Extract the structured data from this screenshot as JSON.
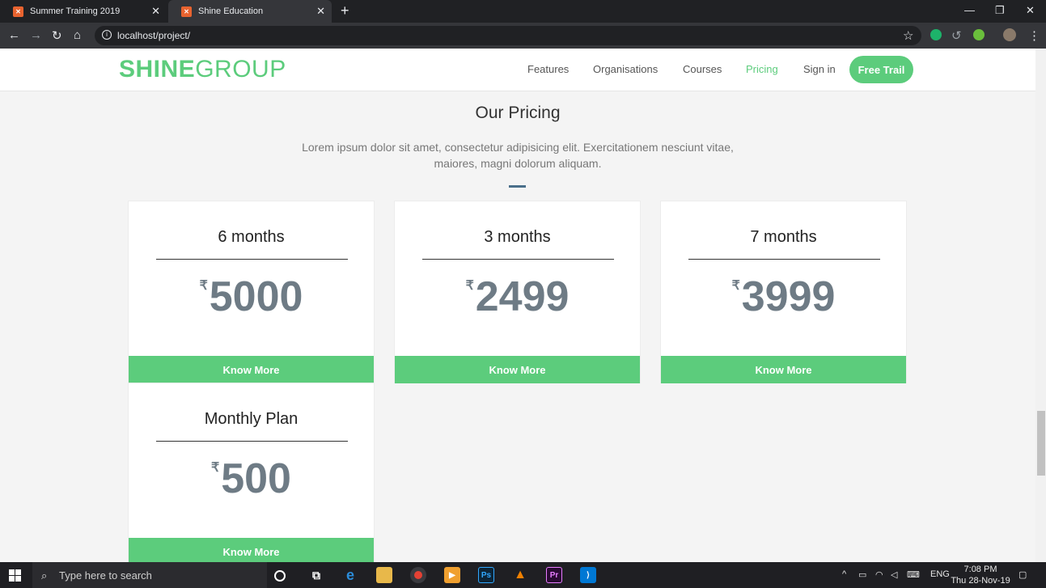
{
  "browser": {
    "tabs": [
      {
        "title": "Summer Training 2019"
      },
      {
        "title": "Shine Education"
      }
    ],
    "url": "localhost/project/"
  },
  "site": {
    "logo_part1": "SHINE",
    "logo_part2": "GROUP",
    "nav": [
      "Features",
      "Organisations",
      "Courses",
      "Pricing",
      "Sign in"
    ],
    "active_nav": "Pricing",
    "cta": "Free Trail"
  },
  "pricing": {
    "title": "Our Pricing",
    "description": "Lorem ipsum dolor sit amet, consectetur adipisicing elit. Exercitationem nesciunt vitae, maiores, magni dolorum aliquam.",
    "currency": "₹",
    "plans": [
      {
        "name": "6 months",
        "price": "5000",
        "button": "Know More"
      },
      {
        "name": "3 months",
        "price": "2499",
        "button": "Know More"
      },
      {
        "name": "7 months",
        "price": "3999",
        "button": "Know More"
      },
      {
        "name": "Monthly Plan",
        "price": "500",
        "button": "Know More"
      }
    ]
  },
  "taskbar": {
    "search_placeholder": "Type here to search",
    "language": "ENG",
    "time": "7:08 PM",
    "date": "Thu 28-Nov-19"
  },
  "colors": {
    "accent": "#5ccc7c",
    "price_text": "#6e7b85",
    "divider_bar": "#4a6f8a"
  }
}
